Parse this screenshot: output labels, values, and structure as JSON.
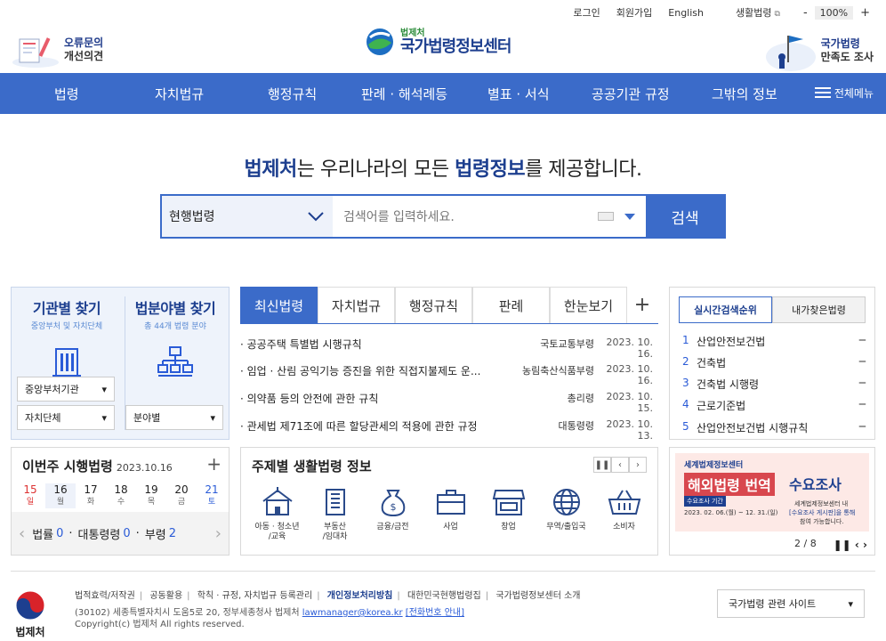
{
  "util": {
    "login": "로그인",
    "join": "회원가입",
    "english": "English",
    "life": "생활법령",
    "zoom_minus": "-",
    "zoom_value": "100%",
    "zoom_plus": "+"
  },
  "header": {
    "left_l1": "오류문의",
    "left_l2": "개선의견",
    "logo_sub": "법제처",
    "logo_main": "국가법령정보센터",
    "right_l1": "국가법령",
    "right_l2": "만족도 조사"
  },
  "nav": {
    "items": [
      "법령",
      "자치법규",
      "행정규칙",
      "판례 · 해석례등",
      "별표 · 서식",
      "공공기관 규정",
      "그밖의 정보"
    ],
    "all": "전체메뉴"
  },
  "hero": {
    "p1": "법제처",
    "p2": "는 우리나라의 모든 ",
    "p3": "법령정보",
    "p4": "를 제공합니다."
  },
  "search": {
    "select": "현행법령",
    "placeholder": "검색어를 입력하세요.",
    "button": "검색"
  },
  "find": {
    "agency_title": "기관별 찾기",
    "agency_sub": "중앙부처 및 자치단체",
    "field_title": "법분야별 찾기",
    "field_sub": "총 44개 법령 분야",
    "dd1": "중앙부처기관",
    "dd2": "자치단체",
    "dd3": "분야별"
  },
  "week": {
    "title": "이번주 시행법령",
    "date": "2023.10.16",
    "plus": "+",
    "days": [
      {
        "n": "15",
        "d": "일"
      },
      {
        "n": "16",
        "d": "월"
      },
      {
        "n": "17",
        "d": "화"
      },
      {
        "n": "18",
        "d": "수"
      },
      {
        "n": "19",
        "d": "목"
      },
      {
        "n": "20",
        "d": "금"
      },
      {
        "n": "21",
        "d": "토"
      }
    ],
    "law_label": "법률",
    "law_count": "0",
    "decree_label": "대통령령",
    "decree_count": "0",
    "ord_label": "부령",
    "ord_count": "2"
  },
  "laws": {
    "tabs": [
      "최신법령",
      "자치법규",
      "행정규칙",
      "판례",
      "한눈보기"
    ],
    "plus": "+",
    "rows": [
      {
        "title": "· 공공주택 특별법 시행규칙",
        "org": "국토교통부령",
        "date": "2023. 10. 16."
      },
      {
        "title": "· 임업 · 산림 공익기능 증진을 위한 직접지불제도 운...",
        "org": "농림축산식품부령",
        "date": "2023. 10. 16."
      },
      {
        "title": "· 의약품 등의 안전에 관한 규칙",
        "org": "총리령",
        "date": "2023. 10. 15."
      },
      {
        "title": "· 관세법 제71조에 따른 할당관세의 적용에 관한 규정",
        "org": "대통령령",
        "date": "2023. 10. 13."
      }
    ]
  },
  "life": {
    "title": "주제별 생활법령 정보",
    "icons": [
      {
        "l1": "아동 · 청소년",
        "l2": "/교육"
      },
      {
        "l1": "부동산",
        "l2": "/임대차"
      },
      {
        "l1": "금융/금전",
        "l2": ""
      },
      {
        "l1": "사업",
        "l2": ""
      },
      {
        "l1": "창업",
        "l2": ""
      },
      {
        "l1": "무역/출입국",
        "l2": ""
      },
      {
        "l1": "소비자",
        "l2": ""
      }
    ]
  },
  "rank": {
    "tab1": "실시간검색순위",
    "tab2": "내가찾은법령",
    "items": [
      {
        "n": "1",
        "t": "산업안전보건법"
      },
      {
        "n": "2",
        "t": "건축법"
      },
      {
        "n": "3",
        "t": "건축법 시행령"
      },
      {
        "n": "4",
        "t": "근로기준법"
      },
      {
        "n": "5",
        "t": "산업안전보건법 시행규칙"
      }
    ]
  },
  "banner": {
    "b1": "세계법제정보센터",
    "b2": "해외법령 번역",
    "b3": "수요조사",
    "b4": "수요조사 기간",
    "b5": "2023. 02. 06.(월) ~ 12. 31.(일)",
    "b6": "세계법제정보센터 내",
    "b7": "[수요조사 게시판]을 통해",
    "b8": "참여 가능합니다.",
    "page": "2 / 8"
  },
  "footer": {
    "logo": "법제처",
    "links": [
      "법적효력/저작권",
      "공동활용",
      "학칙 · 규정, 자치법규 등록관리",
      "개인정보처리방침",
      "대한민국현행법령집",
      "국가법령정보센터 소개"
    ],
    "addr": "(30102) 세종특별자치시 도움5로 20, 정부세종청사 법제처",
    "email": "lawmanager@korea.kr",
    "phone": "[전화번호 안내]",
    "copy": "Copyright(c) 법제처 All rights reserved.",
    "site_select": "국가법령 관련 사이트"
  },
  "colors": {
    "brand_blue": "#3b6bc9",
    "dark_blue": "#1d3f8f"
  }
}
